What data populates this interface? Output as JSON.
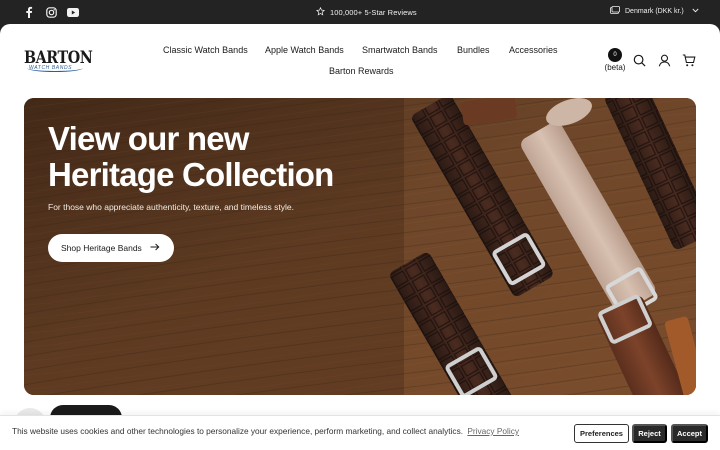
{
  "topbar": {
    "social": [
      {
        "icon": "facebook-icon"
      },
      {
        "icon": "instagram-icon"
      },
      {
        "icon": "youtube-icon"
      }
    ],
    "announcement": "100,000+ 5-Star Reviews",
    "announcement_icon": "star-icon",
    "locale": "Denmark (DKK kr.)",
    "locale_icon": "currency-icon"
  },
  "header": {
    "logo": {
      "main": "BARTON",
      "sub": "WATCH BANDS"
    },
    "nav": [
      {
        "label": "Classic Watch Bands"
      },
      {
        "label": "Apple Watch Bands"
      },
      {
        "label": "Smartwatch Bands"
      },
      {
        "label": "Bundles"
      },
      {
        "label": "Accessories"
      },
      {
        "label": "Barton Rewards"
      }
    ],
    "beta": {
      "badge": "0",
      "label": "(beta)"
    },
    "icons": [
      "search-icon",
      "account-icon",
      "cart-icon"
    ]
  },
  "hero": {
    "title_line1": "View our new",
    "title_line2": "Heritage Collection",
    "subtitle": "For those who appreciate authenticity, texture, and timeless style.",
    "cta_label": "Shop Heritage Bands"
  },
  "cookie_banner": {
    "text": "This website uses cookies and other technologies to personalize your experience, perform marketing, and collect analytics.",
    "link": "Privacy Policy",
    "buttons": {
      "preferences": "Preferences",
      "reject": "Reject",
      "accept": "Accept"
    }
  },
  "colors": {
    "topbar": "#232323",
    "wood": "#6b4427",
    "brand_blue": "#2f5f99",
    "button_dark": "#2a2a2a"
  }
}
